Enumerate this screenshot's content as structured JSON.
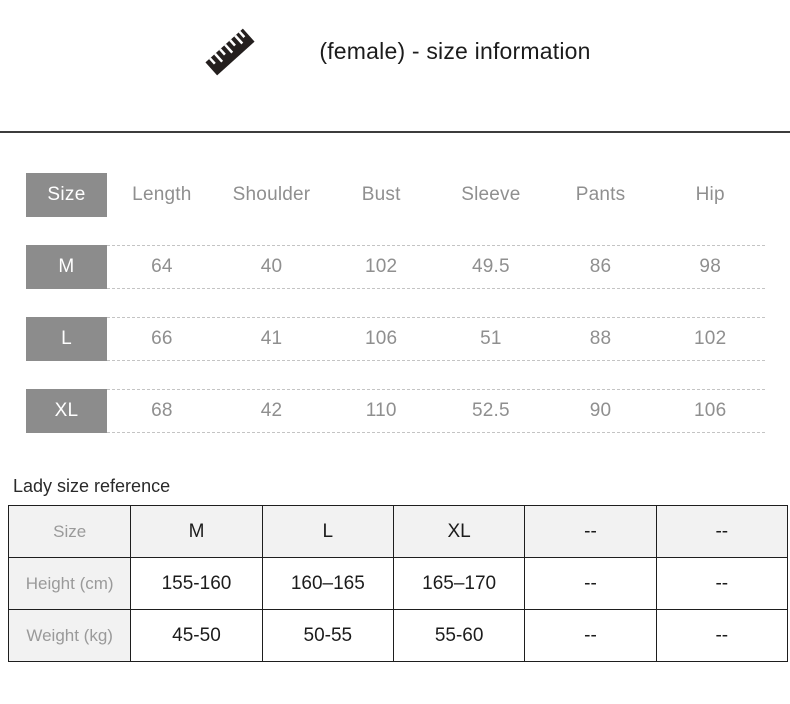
{
  "header": {
    "icon": "ruler-icon",
    "title": "(female) - size information"
  },
  "measurement_table": {
    "columns": [
      "Size",
      "Length",
      "Shoulder",
      "Bust",
      "Sleeve",
      "Pants",
      "Hip"
    ],
    "rows": [
      {
        "size": "M",
        "values": [
          "64",
          "40",
          "102",
          "49.5",
          "86",
          "98"
        ]
      },
      {
        "size": "L",
        "values": [
          "66",
          "41",
          "106",
          "51",
          "88",
          "102"
        ]
      },
      {
        "size": "XL",
        "values": [
          "68",
          "42",
          "110",
          "52.5",
          "90",
          "106"
        ]
      }
    ]
  },
  "reference_table": {
    "title": "Lady size reference",
    "header": [
      "Size",
      "M",
      "L",
      "XL",
      "--",
      "--"
    ],
    "rows": [
      {
        "label": "Height (cm)",
        "values": [
          "155-160",
          "160–165",
          "165–170",
          "--",
          "--"
        ]
      },
      {
        "label": "Weight (kg)",
        "values": [
          "45-50",
          "50-55",
          "55-60",
          "--",
          "--"
        ]
      }
    ]
  },
  "colors": {
    "badge": "#8c8c8c",
    "badge_text": "#ffffff",
    "muted_text": "#8f8f8f",
    "dark_text": "#1c1c1c",
    "dashed_border": "#c4c4c4",
    "table_border": "#1e1e1e",
    "head_fill": "#f2f2f2"
  }
}
